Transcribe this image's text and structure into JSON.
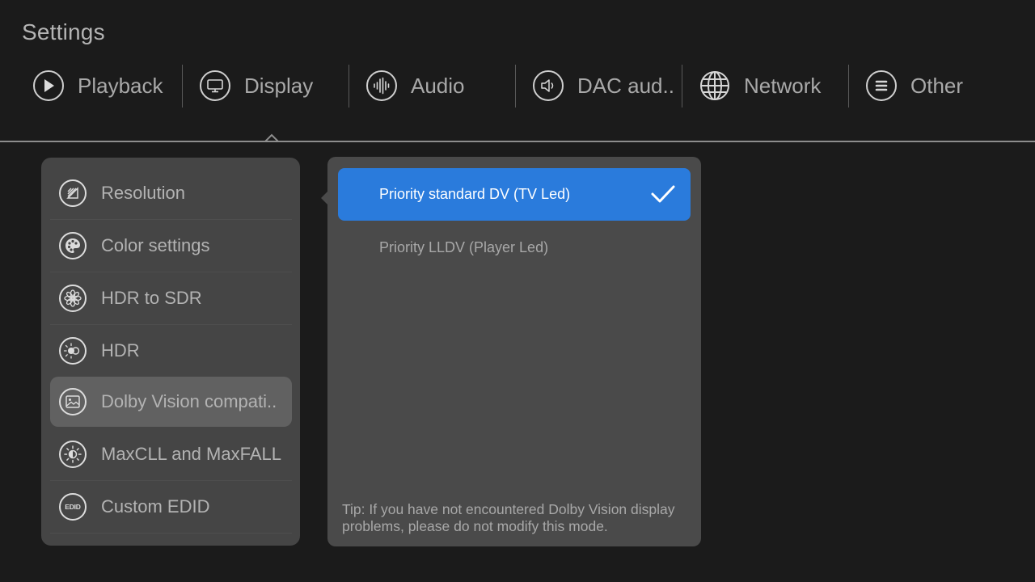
{
  "header": {
    "title": "Settings"
  },
  "tabs": [
    {
      "label": "Playback",
      "icon": "play-icon"
    },
    {
      "label": "Display",
      "icon": "monitor-icon",
      "active": true
    },
    {
      "label": "Audio",
      "icon": "audio-wave-icon"
    },
    {
      "label": "DAC aud..",
      "icon": "speaker-icon"
    },
    {
      "label": "Network",
      "icon": "globe-icon"
    },
    {
      "label": "Other",
      "icon": "menu-lines-icon"
    }
  ],
  "display_menu": {
    "items": [
      {
        "label": "Resolution",
        "icon": "resolution-icon"
      },
      {
        "label": "Color settings",
        "icon": "palette-icon"
      },
      {
        "label": "HDR to SDR",
        "icon": "flower-icon"
      },
      {
        "label": "HDR",
        "icon": "hdr-sun-icon"
      },
      {
        "label": "Dolby Vision compati..",
        "icon": "image-icon",
        "selected": true
      },
      {
        "label": "MaxCLL and MaxFALL",
        "icon": "brightness-icon"
      },
      {
        "label": "Custom EDID",
        "icon": "edid-icon",
        "icon_text": "EDID"
      }
    ]
  },
  "options_panel": {
    "options": [
      {
        "label": "Priority standard DV (TV Led)",
        "selected": true
      },
      {
        "label": "Priority LLDV (Player Led)",
        "selected": false
      }
    ],
    "tip": "Tip: If you have not encountered Dolby Vision display problems, please do not modify this mode."
  },
  "colors": {
    "accent": "#2a7bdc",
    "background": "#1b1b1b",
    "menu_bg": "#454545",
    "panel_bg": "#4a4a4a"
  }
}
